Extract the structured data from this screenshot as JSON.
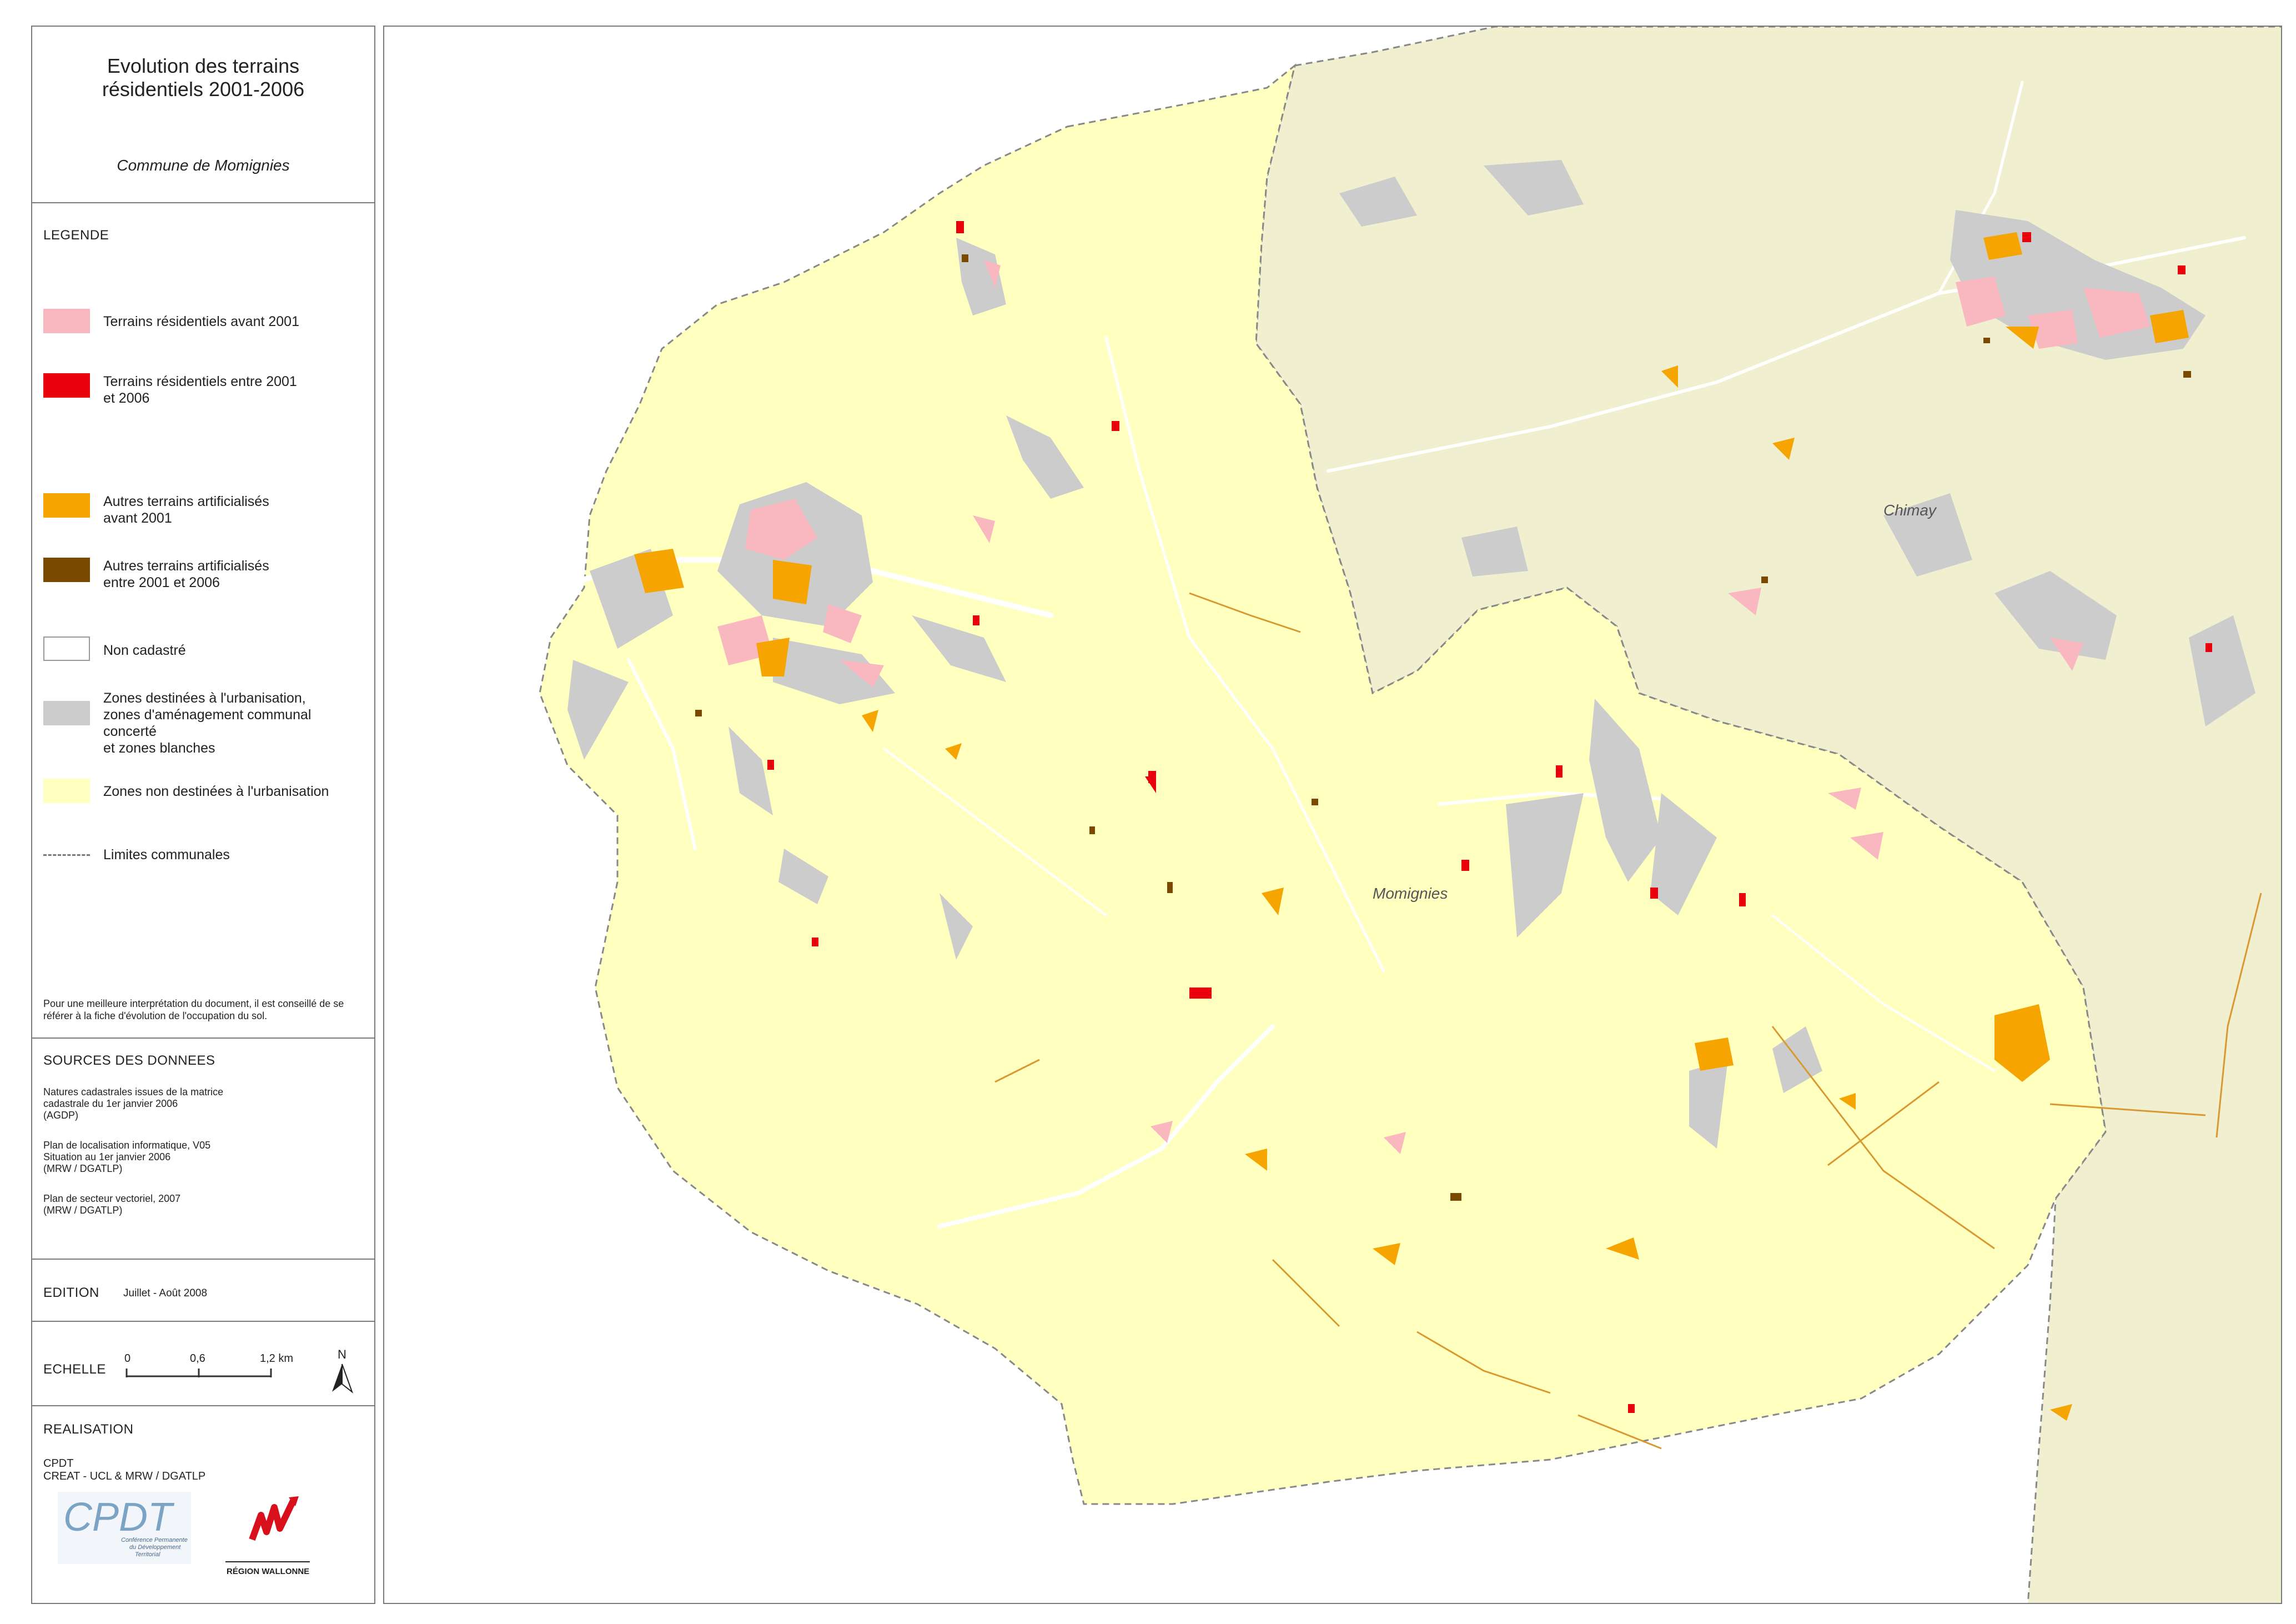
{
  "title": "Evolution des terrains\nrésidentiels 2001-2006",
  "subtitle": "Commune de Momignies",
  "legend": {
    "heading": "LEGENDE",
    "items": [
      {
        "label": "Terrains résidentiels avant 2001",
        "color": "#f9b8c0"
      },
      {
        "label": "Terrains résidentiels entre 2001\net 2006",
        "color": "#e8000b"
      },
      {
        "label": "Autres terrains artificialisés\navant 2001",
        "color": "#f5a400"
      },
      {
        "label": "Autres terrains artificialisés\nentre 2001 et 2006",
        "color": "#7a4a00"
      },
      {
        "label": "Non cadastré",
        "color": "#ffffff"
      },
      {
        "label": "Zones destinées à l'urbanisation,\nzones d'aménagement communal concerté\net zones blanches",
        "color": "#cccccc"
      },
      {
        "label": "Zones non destinées à l'urbanisation",
        "color": "#ffffc0"
      },
      {
        "label": "Limites communales",
        "color": "#777777"
      }
    ],
    "note": "Pour une meilleure interprétation du document, il est conseillé de se référer à la fiche d'évolution de l'occupation du sol."
  },
  "sources": {
    "heading": "SOURCES DES DONNEES",
    "entries": [
      "Natures cadastrales issues de la matrice\ncadastrale du 1er janvier 2006\n(AGDP)",
      "Plan de localisation informatique, V05\nSituation au 1er janvier 2006\n(MRW / DGATLP)",
      "Plan de secteur vectoriel, 2007\n(MRW / DGATLP)"
    ]
  },
  "edition": {
    "label": "EDITION",
    "value": "Juillet - Août 2008"
  },
  "scale": {
    "label": "ECHELLE",
    "ticks": [
      "0",
      "0,6",
      "1,2 km"
    ],
    "north": "N"
  },
  "realisation": {
    "heading": "REALISATION",
    "text": "CPDT\nCREAT - UCL & MRW / DGATLP",
    "logo_cpdt": "CPDT",
    "logo_cpdt_sub": "Conférence Permanente\ndu Développement\nTerritorial",
    "logo_rw": "RÉGION WALLONNE"
  },
  "map": {
    "labels": {
      "main": "Momignies",
      "neighbor": "Chimay"
    },
    "colors": {
      "commune": "#ffffc0",
      "neighbor": "#f0efcf",
      "urban": "#cccccc",
      "resid_old": "#f9b8c0",
      "resid_new": "#e8000b",
      "artif_old": "#f5a400",
      "artif_new": "#7a4a00"
    }
  }
}
